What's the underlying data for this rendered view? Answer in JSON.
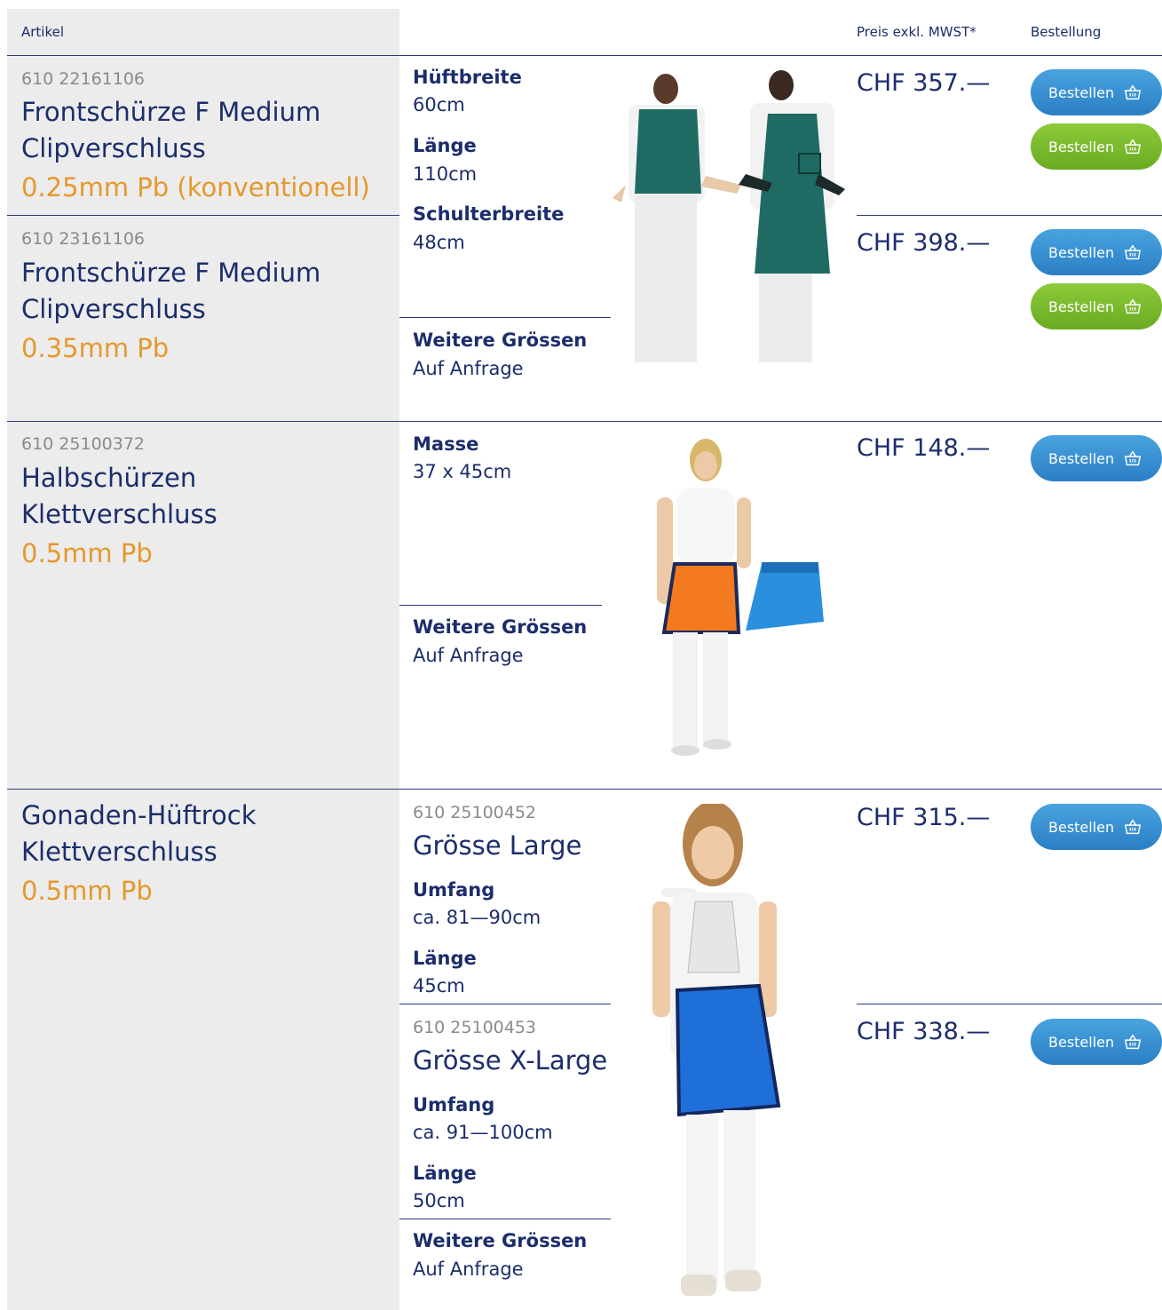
{
  "header": {
    "artikel": "Artikel",
    "preis": "Preis exkl. MWST*",
    "bestellung": "Bestellung"
  },
  "products": [
    {
      "article_number": "610 22161106",
      "title_lines": [
        "Frontschürze F Medium",
        "Clipverschluss"
      ],
      "spec": "0.25mm Pb (konventionell)",
      "price": "CHF 357.—",
      "buttons": [
        "Bestellen",
        "Bestellen"
      ]
    },
    {
      "article_number": "610 23161106",
      "title_lines": [
        "Frontschürze F Medium",
        "Clipverschluss"
      ],
      "spec": "0.35mm Pb",
      "price": "CHF 398.—",
      "buttons": [
        "Bestellen",
        "Bestellen"
      ]
    },
    {
      "article_number": "610 25100372",
      "title_lines": [
        "Halbschürzen",
        "Klettverschluss"
      ],
      "spec": "0.5mm Pb",
      "price": "CHF 148.—",
      "buttons": [
        "Bestellen"
      ]
    },
    {
      "title_lines": [
        "Gonaden-Hüftrock",
        "Klettverschluss"
      ],
      "spec": "0.5mm Pb",
      "variants": [
        {
          "article_number": "610 25100452",
          "size": "Grösse Large",
          "umfang_label": "Umfang",
          "umfang_value": "ca. 81—90cm",
          "laenge_label": "Länge",
          "laenge_value": "45cm",
          "price": "CHF 315.—",
          "button": "Bestellen"
        },
        {
          "article_number": "610 25100453",
          "size": "Grösse X-Large",
          "umfang_label": "Umfang",
          "umfang_value": "ca. 91—100cm",
          "laenge_label": "Länge",
          "laenge_value": "50cm",
          "price": "CHF 338.—",
          "button": "Bestellen"
        }
      ]
    }
  ],
  "specs_front": {
    "hueftbreite_label": "Hüftbreite",
    "hueftbreite_value": "60cm",
    "laenge_label": "Länge",
    "laenge_value": "110cm",
    "schulterbreite_label": "Schulterbreite",
    "schulterbreite_value": "48cm"
  },
  "specs_half": {
    "masse_label": "Masse",
    "masse_value": "37 x 45cm"
  },
  "weitere": {
    "label": "Weitere Grössen",
    "value": "Auf Anfrage"
  },
  "colors": {
    "navy": "#1b2d6b",
    "orange": "#e6982c",
    "button_blue": "#3590d4",
    "button_green": "#7cbc2e",
    "panel_gray": "#ececec"
  },
  "icons": {
    "basket": "shopping-basket-icon"
  }
}
